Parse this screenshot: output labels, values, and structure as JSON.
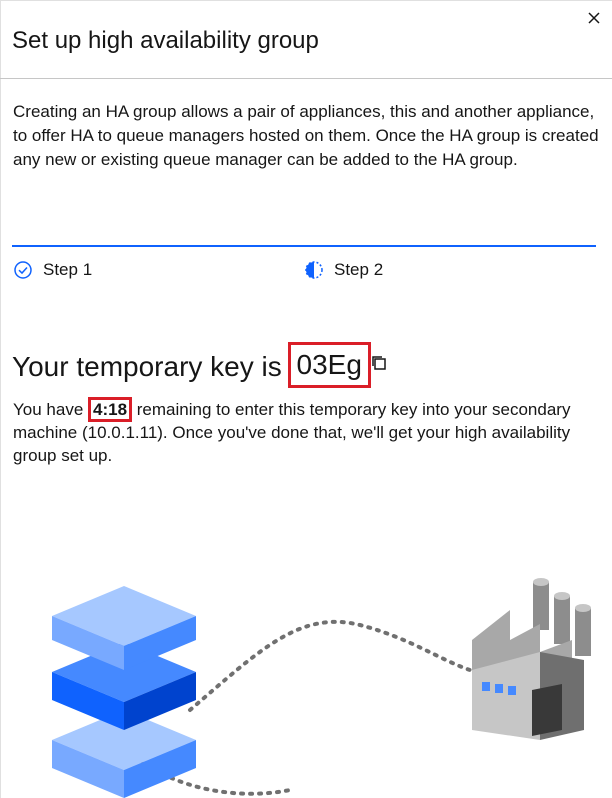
{
  "dialog": {
    "title": "Set up high availability group",
    "close_icon": "close-icon"
  },
  "description": "Creating an HA group allows a pair of appliances, this and another appliance, to offer HA to queue managers hosted on them. Once the HA group is created any new or existing queue manager can be added to the HA group.",
  "progress": {
    "accent": "#0f62fe",
    "steps": [
      {
        "label": "Step 1",
        "state": "complete",
        "icon": "checkmark-outline-icon"
      },
      {
        "label": "Step 2",
        "state": "current",
        "icon": "half-circle-icon"
      }
    ]
  },
  "key": {
    "heading_prefix": "Your temporary key is ",
    "value": "03Eg",
    "copy_icon": "copy-icon"
  },
  "info": {
    "prefix": "You have ",
    "time_remaining": "4:18",
    "suffix": " remaining to enter this temporary key into your secondary machine (10.0.1.11). Once you've done that, we'll get your high availability group set up."
  },
  "illustration": {
    "left": "server-stack-icon",
    "right": "factory-icon"
  },
  "colors": {
    "highlight": "#da1e28",
    "primary": "#0f62fe"
  }
}
